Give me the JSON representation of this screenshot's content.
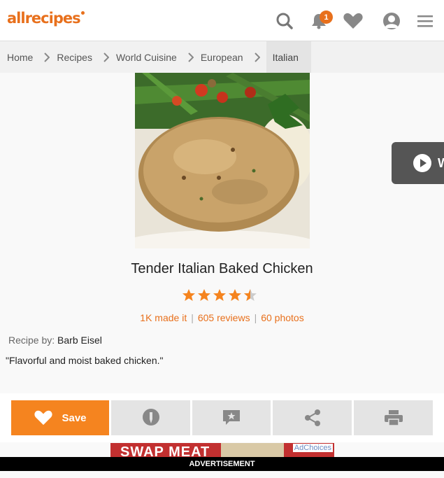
{
  "header": {
    "logo_text": "allrecipes",
    "notification_count": "1",
    "brand_color": "#e8701c"
  },
  "breadcrumb": {
    "items": [
      "Home",
      "Recipes",
      "World Cuisine",
      "European"
    ],
    "active": "Italian"
  },
  "video": {
    "label": "W"
  },
  "recipe": {
    "title": "Tender Italian Baked Chicken",
    "rating": 4.5,
    "rating_max": 5,
    "made_it": "1K made it",
    "reviews": "605 reviews",
    "photos": "60 photos",
    "recipe_by_label": "Recipe by:",
    "author": "Barb Eisel",
    "description": "\"Flavorful and moist baked chicken.\""
  },
  "actions": {
    "save_label": "Save",
    "icons": [
      "heart-icon",
      "made-it-icon",
      "review-icon",
      "share-icon",
      "print-icon"
    ]
  },
  "ad": {
    "banner_text": "SWAP MEAT",
    "choices_label": "AdChoices",
    "label": "ADVERTISEMENT"
  }
}
